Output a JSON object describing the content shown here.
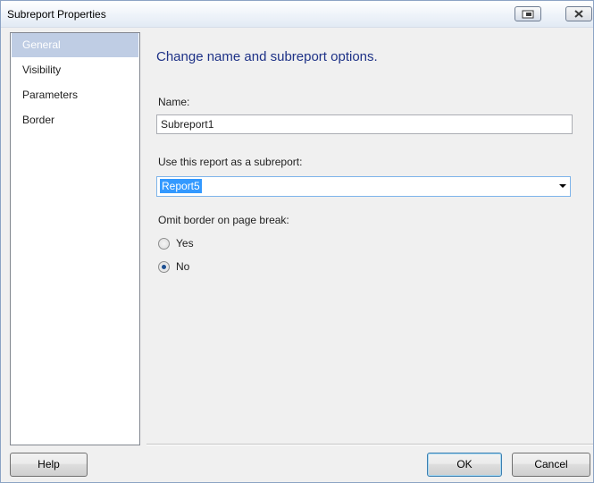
{
  "window": {
    "title": "Subreport Properties"
  },
  "sidebar": {
    "items": [
      {
        "label": "General",
        "selected": true
      },
      {
        "label": "Visibility",
        "selected": false
      },
      {
        "label": "Parameters",
        "selected": false
      },
      {
        "label": "Border",
        "selected": false
      }
    ]
  },
  "main": {
    "header": "Change name and subreport options.",
    "name_label": "Name:",
    "name_value": "Subreport1",
    "subreport_label": "Use this report as a subreport:",
    "subreport_value": "Report5",
    "omit_border_label": "Omit border on page break:",
    "radio_yes_label": "Yes",
    "radio_no_label": "No",
    "radio_selected": "No"
  },
  "footer": {
    "help_label": "Help",
    "ok_label": "OK",
    "cancel_label": "Cancel"
  },
  "colors": {
    "selected_nav_bg": "#bfcde4",
    "header_text": "#1e3287",
    "selection_highlight": "#3399ff"
  }
}
